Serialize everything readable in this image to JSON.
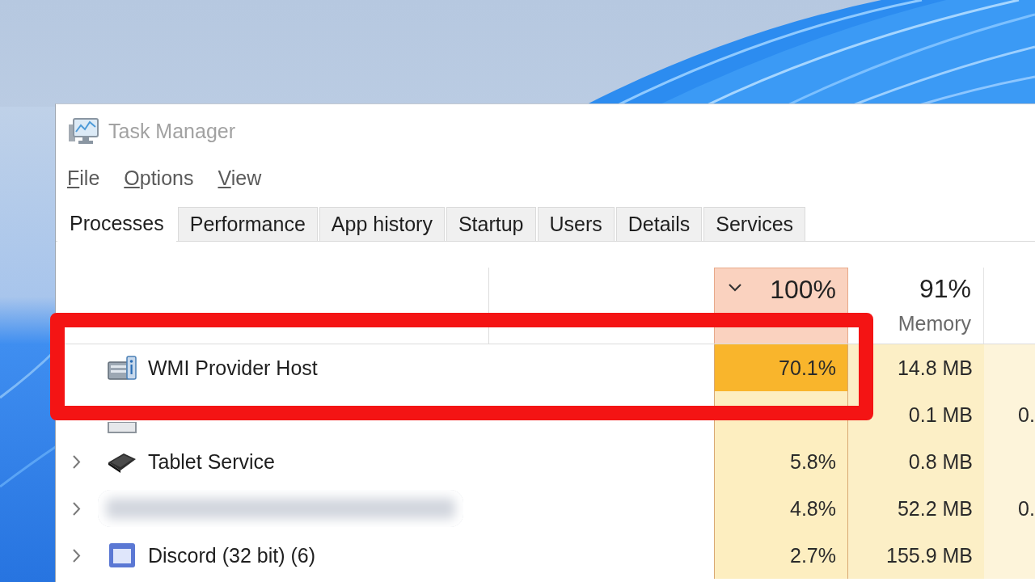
{
  "window": {
    "title": "Task Manager"
  },
  "menu": [
    "File",
    "Options",
    "View"
  ],
  "tabs": [
    {
      "label": "Processes",
      "selected": true
    },
    {
      "label": "Performance",
      "selected": false
    },
    {
      "label": "App history",
      "selected": false
    },
    {
      "label": "Startup",
      "selected": false
    },
    {
      "label": "Users",
      "selected": false
    },
    {
      "label": "Details",
      "selected": false
    },
    {
      "label": "Services",
      "selected": false
    }
  ],
  "table": {
    "header": {
      "cpu": {
        "total": "100%",
        "sorted": true,
        "color": "#fad2bf"
      },
      "memory": {
        "total": "91%",
        "label": "Memory"
      }
    },
    "rows": [
      {
        "expandable": false,
        "redacted": false,
        "name": "WMI Provider Host",
        "cpu": {
          "value": "70.1%",
          "color": "#f9b52c"
        },
        "memory": {
          "value": "14.8 MB",
          "color": "#fcefc6"
        },
        "column_5": {
          "color": "#fdf4da"
        }
      },
      {
        "expandable": false,
        "redacted": false,
        "cpu": {
          "color": "#fdeec0"
        },
        "memory": {
          "value": "0.1 MB",
          "color": "#fcefc6"
        },
        "column_5": {
          "value": "0.",
          "color": "#fdf4da"
        }
      },
      {
        "expandable": true,
        "redacted": false,
        "name": "Tablet Service",
        "cpu": {
          "value": "5.8%",
          "color": "#fdeec0"
        },
        "memory": {
          "value": "0.8 MB",
          "color": "#fcefc6"
        },
        "column_5": {
          "color": "#fdf4da"
        }
      },
      {
        "expandable": true,
        "redacted": true,
        "cpu": {
          "value": "4.8%",
          "color": "#fdeec0"
        },
        "memory": {
          "value": "52.2 MB",
          "color": "#fcefc6"
        },
        "column_5": {
          "value": "0.",
          "color": "#fdf4da"
        }
      },
      {
        "expandable": true,
        "redacted": false,
        "name": "Discord (32 bit) (6)",
        "cpu": {
          "value": "2.7%",
          "color": "#fdeec0"
        },
        "memory": {
          "value": "155.9 MB",
          "color": "#fcefc6"
        },
        "column_5": {
          "color": "#fdf4da"
        }
      }
    ]
  }
}
